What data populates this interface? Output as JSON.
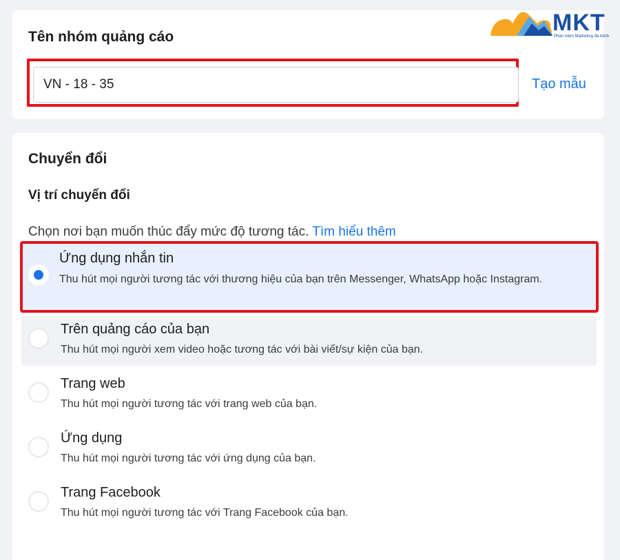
{
  "brand": {
    "logo_text": "MKT",
    "tagline": "Phần mềm Marketing đa kênh",
    "colors": {
      "blue": "#1b4fa3",
      "orange": "#f5a623",
      "light_blue": "#5aa7e8"
    }
  },
  "ad_set_name": {
    "title": "Tên nhóm quảng cáo",
    "input_value": "VN - 18 - 35",
    "template_link": "Tạo mẫu"
  },
  "conversion": {
    "title": "Chuyển đổi",
    "subtitle": "Vị trí chuyển đổi",
    "description": "Chọn nơi bạn muốn thúc đẩy mức độ tương tác.",
    "learn_more": "Tìm hiểu thêm",
    "options": [
      {
        "label": "Ứng dụng nhắn tin",
        "text": "Thu hút mọi người tương tác với thương hiệu của bạn trên Messenger, WhatsApp hoặc Instagram.",
        "selected": true
      },
      {
        "label": "Trên quảng cáo của bạn",
        "text": "Thu hút mọi người xem video hoặc tương tác với bài viết/sự kiện của bạn.",
        "selected": false
      },
      {
        "label": "Trang web",
        "text": "Thu hút mọi người tương tác với trang web của bạn.",
        "selected": false
      },
      {
        "label": "Ứng dụng",
        "text": "Thu hút mọi người tương tác với ứng dụng của bạn.",
        "selected": false
      },
      {
        "label": "Trang Facebook",
        "text": "Thu hút mọi người tương tác với Trang Facebook của bạn.",
        "selected": false
      }
    ]
  },
  "colors": {
    "accent": "#1b74e4",
    "highlight_border": "#e0141e",
    "selected_bg": "#e7f0fc"
  }
}
